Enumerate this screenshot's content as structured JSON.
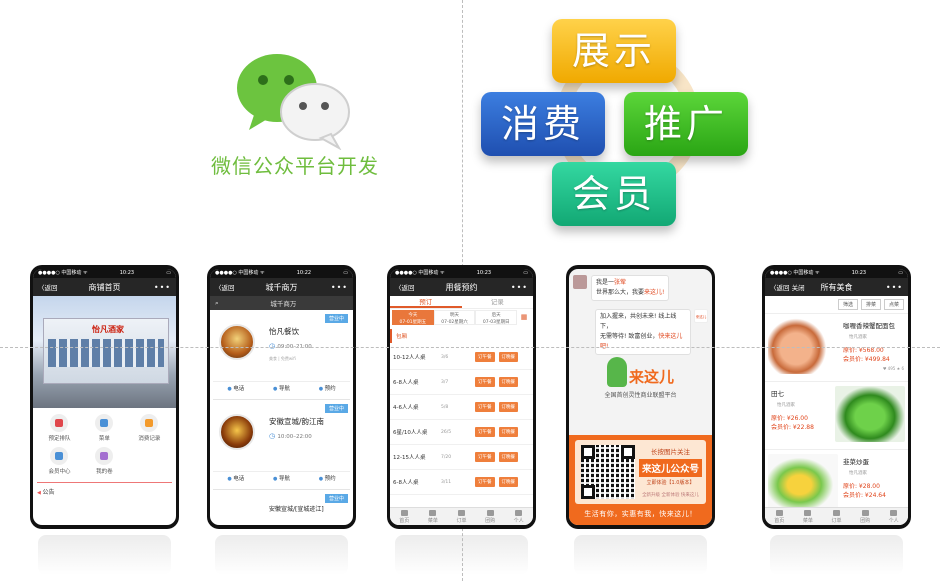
{
  "logo": {
    "caption": "微信公众平台开发"
  },
  "tiles": {
    "show": "展示",
    "spend": "消费",
    "promo": "推广",
    "member": "会员"
  },
  "status": {
    "carrier": "●●●●○ 中国移动 ᯤ",
    "time1": "10:23",
    "time2": "10:22",
    "battery": "▭"
  },
  "phone1": {
    "back": "〈返回",
    "title": "商铺首页",
    "more": "•••",
    "sign": "怡凡酒家",
    "grid": [
      "预定排队",
      "菜单",
      "消费记录",
      "会员中心",
      "我的卷"
    ],
    "notice": "公告"
  },
  "phone2": {
    "back": "〈返回",
    "title": "城千商万",
    "more": "•••",
    "search_icon": "⌕",
    "subtitle": "城千商万",
    "badge": "营业中",
    "stores": [
      {
        "name": "怡凡餐饮",
        "hours": "09:00–21:00",
        "meta": "美食 | 免费wifi"
      },
      {
        "name": "安徽宣城/韵江南",
        "hours": "10:00–22:00",
        "meta": ""
      }
    ],
    "actions": [
      "电话",
      "导航",
      "预约"
    ],
    "peek": "安徽宣城/[宣城迹江]"
  },
  "phone3": {
    "back": "〈返回",
    "title": "用餐预约",
    "more": "•••",
    "tabs": [
      "预订",
      "记录"
    ],
    "days": [
      {
        "a": "今天",
        "b": "07-01星期五"
      },
      {
        "a": "明天",
        "b": "07-02星期六"
      },
      {
        "a": "后天",
        "b": "07-03星期日"
      }
    ],
    "cal_icon": "▦",
    "section": "包厢",
    "rows": [
      {
        "size": "10-12人人桌",
        "count": "3/6"
      },
      {
        "size": "6-8人人桌",
        "count": "3/7"
      },
      {
        "size": "4-6人人桌",
        "count": "5/8"
      },
      {
        "size": "6星/10人人桌",
        "count": "26/5"
      },
      {
        "size": "12-15人人桌",
        "count": "7/20"
      },
      {
        "size": "6-8人人桌",
        "count": "3/11"
      }
    ],
    "btn_lunch": "订午餐",
    "btn_dinner": "订晚餐"
  },
  "phone4": {
    "msg1_line1_pre": "我是一",
    "msg1_name": "张荤",
    "msg1_line2_pre": "世界那么大，我要",
    "msg1_line2_hl": "来这儿!",
    "msg2_line1": "加入握来，共创未来! 线上线下，",
    "msg2_line2_pre": "无需等待! 致富创业，",
    "msg2_line2_hl": "快来这儿吧!",
    "msg2_avatar": "来这儿",
    "brand_name": "来这儿",
    "brand_line": "全国首创灵性商业联盟平台",
    "qr_t1": "长按图片关注",
    "qr_t2": "来这儿公众号",
    "qr_t3": "立即体验【1.0版本】",
    "qr_t4": "全新升级 全新体验 快来这儿",
    "slogan": "生活有你，实惠有我，快来这儿！"
  },
  "phone5": {
    "back": "〈返回 关闭",
    "title": "所有美食",
    "more": "•••",
    "filters": [
      "筛选",
      "排菜",
      "点菜"
    ],
    "dishes": [
      {
        "name": "咖喱香辣蟹配面包",
        "src": "怡凡酒家",
        "orig": "原价: ¥568.00",
        "member": "会员价: ¥499.84",
        "stats": "♥ 495 ★ 6"
      },
      {
        "name": "田七",
        "src": "怡凡酒家",
        "orig": "原价: ¥26.00",
        "member": "会员价: ¥22.88",
        "stats": ""
      },
      {
        "name": "韭菜炒蛋",
        "src": "怡凡酒家",
        "orig": "原价: ¥28.00",
        "member": "会员价: ¥24.64",
        "stats": ""
      }
    ]
  },
  "tabbar": [
    "首页",
    "菜单",
    "订单",
    "团购",
    "个人"
  ],
  "colors": {
    "wechat_green": "#6fbd3e",
    "accent_orange": "#f06a1e"
  }
}
